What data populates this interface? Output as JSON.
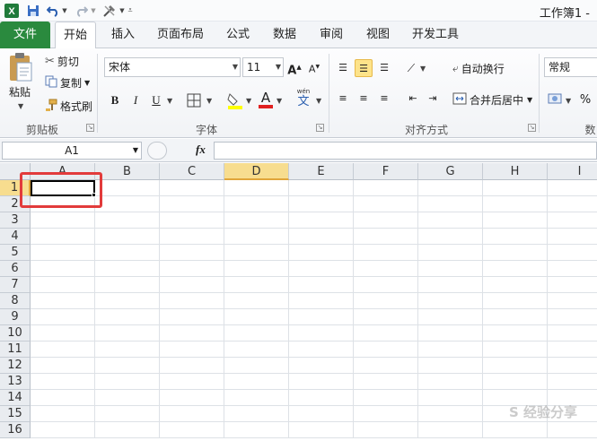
{
  "window": {
    "title": "工作簿1 -"
  },
  "tabs": [
    {
      "label": "文件"
    },
    {
      "label": "开始"
    },
    {
      "label": "插入"
    },
    {
      "label": "页面布局"
    },
    {
      "label": "公式"
    },
    {
      "label": "数据"
    },
    {
      "label": "审阅"
    },
    {
      "label": "视图"
    },
    {
      "label": "开发工具"
    }
  ],
  "clipboard": {
    "paste_label": "粘贴",
    "cut_label": "剪切",
    "copy_label": "复制",
    "format_painter_label": "格式刷",
    "group_label": "剪贴板"
  },
  "font": {
    "font_name": "宋体",
    "font_size": "11",
    "bold": "B",
    "italic": "I",
    "underline": "U",
    "font_color_glyph": "A",
    "phonetic_glyph": "文",
    "phonetic_top": "wén",
    "group_label": "字体"
  },
  "alignment": {
    "wrap_text_label": "自动换行",
    "merge_center_label": "合并后居中",
    "group_label": "对齐方式"
  },
  "number": {
    "format_value": "常规",
    "percent_glyph": "%",
    "group_label_partial": "数"
  },
  "formula_bar": {
    "name_box": "A1",
    "fx_label": "fx"
  },
  "grid": {
    "columns": [
      "A",
      "B",
      "C",
      "D",
      "E",
      "F",
      "G",
      "H",
      "I"
    ],
    "rows": [
      "1",
      "2",
      "3",
      "4",
      "5",
      "6",
      "7",
      "8",
      "9",
      "10",
      "11",
      "12",
      "13",
      "14",
      "15",
      "16"
    ],
    "active_cell": "A1",
    "highlighted_column": "D"
  },
  "watermark": "S 经验分享",
  "colors": {
    "file_tab": "#2a8a3e",
    "highlight_border": "#e23b3b",
    "header_active": "#f7dd8f"
  }
}
